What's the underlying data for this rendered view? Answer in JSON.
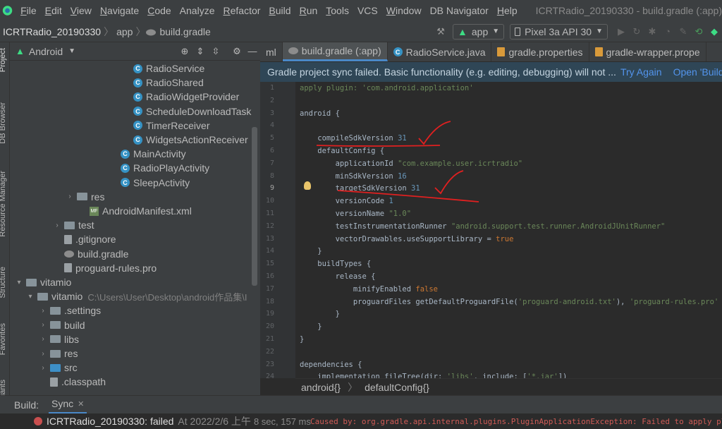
{
  "menu": {
    "items": [
      {
        "u": "F",
        "rest": "ile"
      },
      {
        "u": "E",
        "rest": "dit"
      },
      {
        "u": "V",
        "rest": "iew"
      },
      {
        "u": "N",
        "rest": "avigate"
      },
      {
        "u": "C",
        "rest": "ode"
      },
      {
        "u": "",
        "rest": "Analyze"
      },
      {
        "u": "R",
        "rest": "efactor"
      },
      {
        "u": "B",
        "rest": "uild"
      },
      {
        "u": "R",
        "rest": "un"
      },
      {
        "u": "T",
        "rest": "ools"
      },
      {
        "u": "",
        "rest": "VCS"
      },
      {
        "u": "W",
        "rest": "indow"
      },
      {
        "u": "",
        "rest": "DB Navigator"
      },
      {
        "u": "H",
        "rest": "elp"
      }
    ],
    "title": "ICRTRadio_20190330 - build.gradle (:app)"
  },
  "nav": {
    "crumbs": [
      "ICRTRadio_20190330",
      "app",
      "build.gradle"
    ],
    "run_config": "app",
    "device": "Pixel 3a API 30"
  },
  "side_tabs": [
    "Project",
    "DB Browser",
    "Resource Manager",
    "Structure",
    "Favorites",
    "Build Variants"
  ],
  "project": {
    "view": "Android",
    "rows": [
      {
        "label": "RadioService",
        "kind": "class",
        "indent": 160,
        "chev": ""
      },
      {
        "label": "RadioShared",
        "kind": "class",
        "indent": 160,
        "chev": ""
      },
      {
        "label": "RadioWidgetProvider",
        "kind": "class",
        "indent": 160,
        "chev": ""
      },
      {
        "label": "ScheduleDownloadTask",
        "kind": "class",
        "indent": 160,
        "chev": ""
      },
      {
        "label": "TimerReceiver",
        "kind": "class",
        "indent": 160,
        "chev": ""
      },
      {
        "label": "WidgetsActionReceiver",
        "kind": "class",
        "indent": 160,
        "chev": ""
      },
      {
        "label": "MainActivity",
        "kind": "class",
        "indent": 142,
        "chev": ""
      },
      {
        "label": "RadioPlayActivity",
        "kind": "class",
        "indent": 142,
        "chev": ""
      },
      {
        "label": "SleepActivity",
        "kind": "class",
        "indent": 142,
        "chev": ""
      },
      {
        "label": "res",
        "kind": "folder",
        "indent": 80,
        "chev": ">"
      },
      {
        "label": "AndroidManifest.xml",
        "kind": "manifest",
        "indent": 98,
        "chev": ""
      },
      {
        "label": "test",
        "kind": "folder",
        "indent": 62,
        "chev": ">"
      },
      {
        "label": ".gitignore",
        "kind": "file",
        "indent": 62,
        "chev": ""
      },
      {
        "label": "build.gradle",
        "kind": "gradle",
        "indent": 62,
        "chev": ""
      },
      {
        "label": "proguard-rules.pro",
        "kind": "file",
        "indent": 62,
        "chev": ""
      },
      {
        "label": "vitamio",
        "kind": "module",
        "indent": 8,
        "chev": "v"
      },
      {
        "label": "vitamio",
        "kind": "folder",
        "indent": 24,
        "chev": "v",
        "hint": "C:\\Users\\User\\Desktop\\android作品集\\I"
      },
      {
        "label": ".settings",
        "kind": "folder",
        "indent": 42,
        "chev": ">"
      },
      {
        "label": "build",
        "kind": "folder",
        "indent": 42,
        "chev": ">"
      },
      {
        "label": "libs",
        "kind": "folder",
        "indent": 42,
        "chev": ">"
      },
      {
        "label": "res",
        "kind": "folder",
        "indent": 42,
        "chev": ">"
      },
      {
        "label": "src",
        "kind": "folderblue",
        "indent": 42,
        "chev": ">"
      },
      {
        "label": ".classpath",
        "kind": "file",
        "indent": 42,
        "chev": ""
      }
    ]
  },
  "tabs": [
    {
      "label": "ml"
    },
    {
      "label": "build.gradle (:app)",
      "active": true
    },
    {
      "label": "RadioService.java"
    },
    {
      "label": "gradle.properties"
    },
    {
      "label": "gradle-wrapper.prope"
    }
  ],
  "banner": {
    "text": "Gradle project sync failed. Basic functionality (e.g. editing, debugging) will not ...",
    "try_again": "Try Again",
    "open_build": "Open 'Build' V"
  },
  "code": [
    [
      [
        "str",
        "apply plugin: "
      ],
      [
        "str",
        "'com.android.application'"
      ]
    ],
    [],
    [
      [
        "",
        "android {"
      ]
    ],
    [],
    [
      [
        "",
        "    compileSdkVersion "
      ],
      [
        "num",
        "31"
      ]
    ],
    [
      [
        "",
        "    defaultConfig {"
      ]
    ],
    [
      [
        "",
        "        applicationId "
      ],
      [
        "str",
        "\"com.example.user.icrtradio\""
      ]
    ],
    [
      [
        "",
        "        minSdkVersion "
      ],
      [
        "num",
        "16"
      ]
    ],
    [
      [
        "",
        "        targetSdkVersion "
      ],
      [
        "num",
        "31"
      ]
    ],
    [
      [
        "",
        "        versionCode "
      ],
      [
        "num",
        "1"
      ]
    ],
    [
      [
        "",
        "        versionName "
      ],
      [
        "str",
        "\"1.0\""
      ]
    ],
    [
      [
        "",
        "        testInstrumentationRunner "
      ],
      [
        "str",
        "\"android.support.test.runner.AndroidJUnitRunner\""
      ]
    ],
    [
      [
        "",
        "        vectorDrawables.useSupportLibrary = "
      ],
      [
        "kw",
        "true"
      ]
    ],
    [
      [
        "",
        "    }"
      ]
    ],
    [
      [
        "",
        "    buildTypes {"
      ]
    ],
    [
      [
        "",
        "        release {"
      ]
    ],
    [
      [
        "",
        "            minifyEnabled "
      ],
      [
        "kw",
        "false"
      ]
    ],
    [
      [
        "",
        "            proguardFiles getDefaultProguardFile("
      ],
      [
        "str",
        "'proguard-android.txt'"
      ],
      [
        "",
        "), "
      ],
      [
        "str",
        "'proguard-rules.pro'"
      ]
    ],
    [
      [
        "",
        "        }"
      ]
    ],
    [
      [
        "",
        "    }"
      ]
    ],
    [
      [
        "",
        "}"
      ]
    ],
    [],
    [
      [
        "",
        "dependencies {"
      ]
    ],
    [
      [
        "",
        "    implementation fileTree(dir: "
      ],
      [
        "str",
        "'libs'"
      ],
      [
        "",
        ", include: ["
      ],
      [
        "str",
        "'*.jar'"
      ],
      [
        "",
        "])"
      ]
    ]
  ],
  "editor_crumbs": [
    "android{}",
    "defaultConfig{}"
  ],
  "bottom": {
    "build": "Build:",
    "sync": "Sync"
  },
  "status": {
    "project": "ICRTRadio_20190330:",
    "state": "failed",
    "time": "At 2022/2/6 上午",
    "duration": "8 sec, 157 ms",
    "error": "Caused by: org.gradle.api.internal.plugins.PluginApplicationException: Failed to apply plu"
  }
}
